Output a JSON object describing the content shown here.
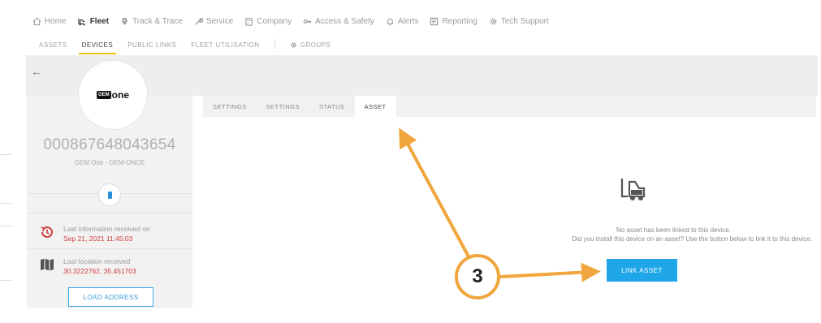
{
  "nav": {
    "items": [
      {
        "label": "Home",
        "icon": "home-icon"
      },
      {
        "label": "Fleet",
        "icon": "truck-icon",
        "active": true
      },
      {
        "label": "Track & Trace",
        "icon": "pin-icon"
      },
      {
        "label": "Service",
        "icon": "wrench-icon"
      },
      {
        "label": "Company",
        "icon": "building-icon"
      },
      {
        "label": "Access & Safety",
        "icon": "key-icon"
      },
      {
        "label": "Alerts",
        "icon": "bell-icon"
      },
      {
        "label": "Reporting",
        "icon": "report-icon"
      },
      {
        "label": "Tech Support",
        "icon": "gear-icon"
      }
    ]
  },
  "subnav": {
    "assets": "ASSETS",
    "devices": "DEVICES",
    "public_links": "PUBLIC LINKS",
    "fleet_utilisation": "FLEET UTILISATION",
    "groups": "GROUPS"
  },
  "device": {
    "logo_gem": "GEM",
    "logo_one": "one",
    "serial": "000867648043654",
    "model": "GEM One - GEM-ONCE",
    "last_info_label": "Last information received on",
    "last_info_value": "Sep 21, 2021 11:45:03",
    "last_location_label": "Last location received",
    "last_location_value": "30.3222762, 35.451703",
    "load_address": "LOAD ADDRESS"
  },
  "tabs": [
    "SETTINGS",
    "SETTINGS",
    "STATUS",
    "ASSET"
  ],
  "asset_panel": {
    "line1": "No asset has been linked to this device.",
    "line2": "Did you install this device on an asset? Use the button below to link it to this device.",
    "link_button": "LINK ASSET"
  },
  "annotation": {
    "step": "3",
    "color": "#f0a63c"
  }
}
